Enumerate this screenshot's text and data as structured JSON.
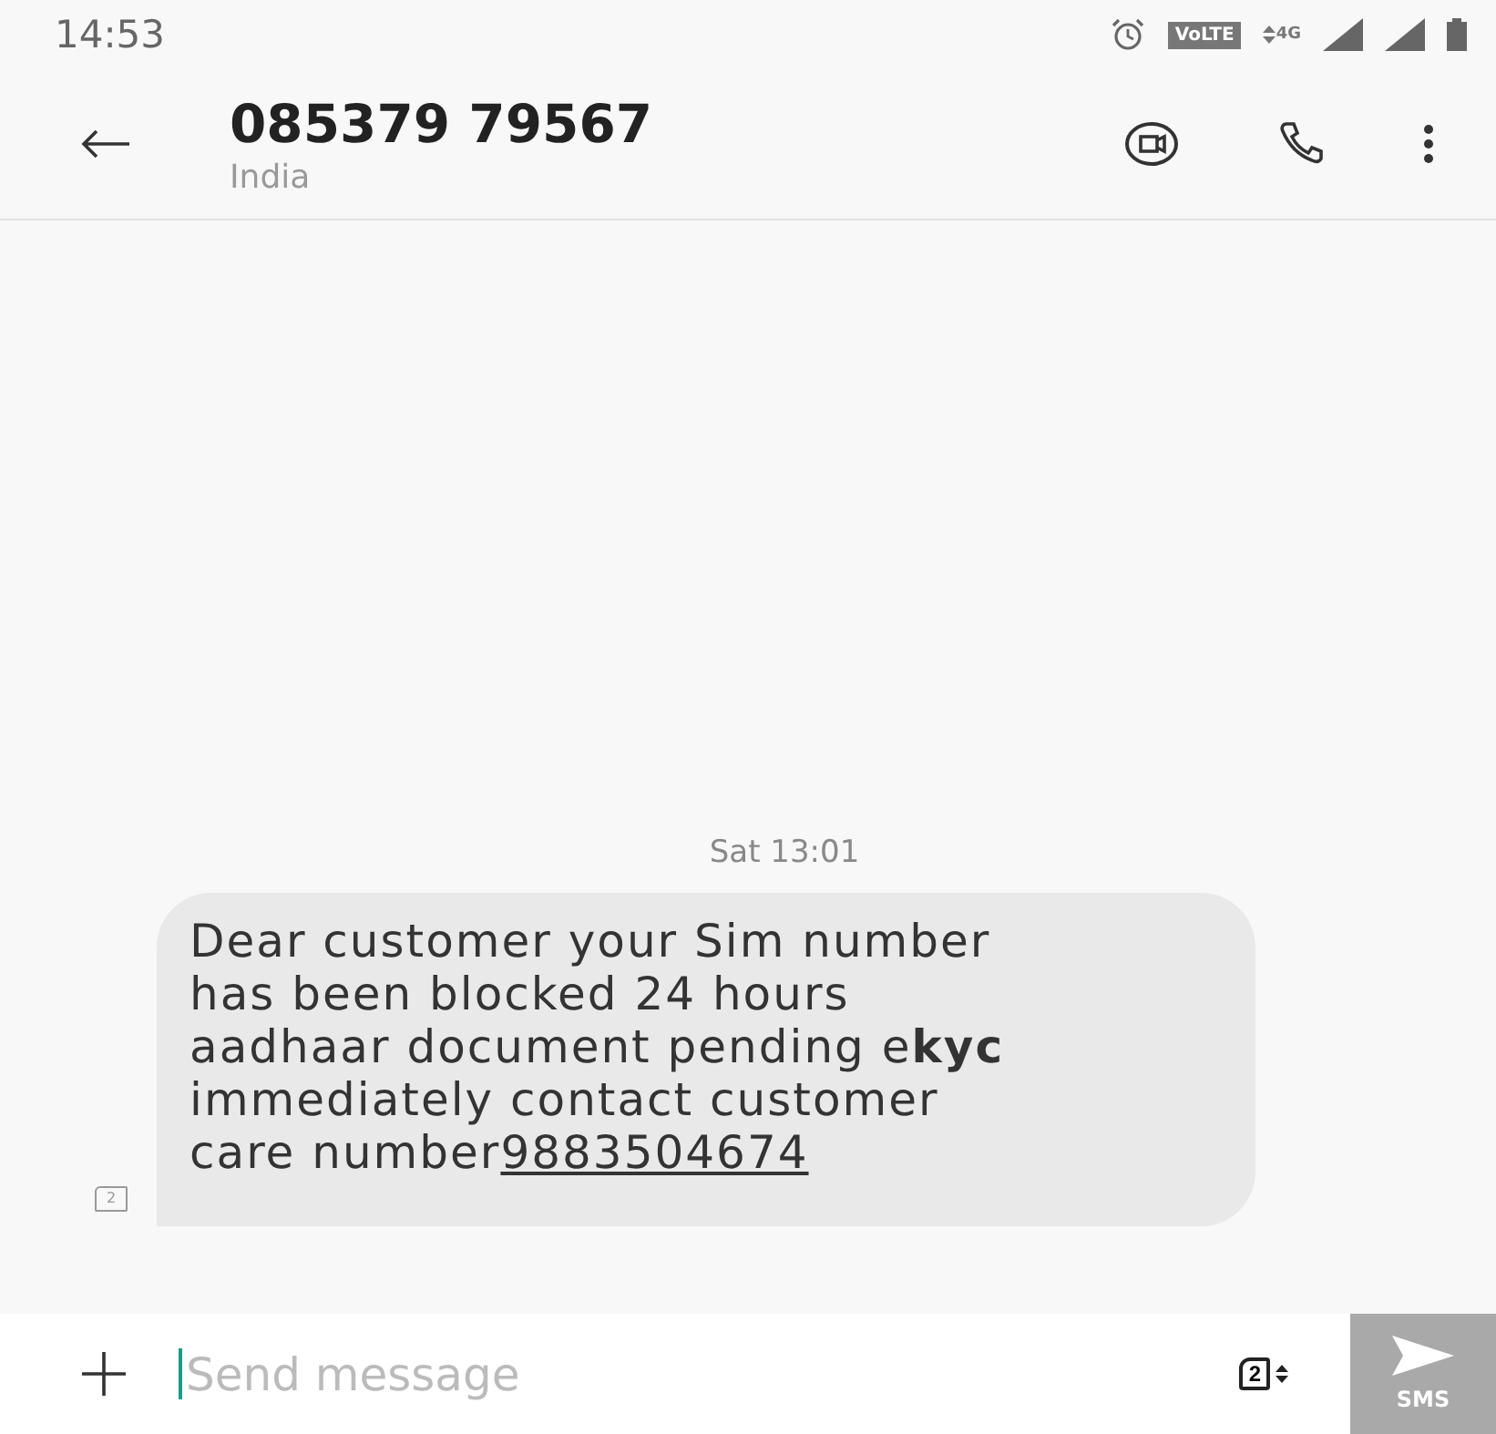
{
  "status_bar": {
    "time": "14:53",
    "volte": "VoLTE",
    "network": "4G"
  },
  "header": {
    "title": "085379 79567",
    "subtitle": "India"
  },
  "conversation": {
    "timestamp": "Sat 13:01",
    "sim_label": "2",
    "message": {
      "text": "Dear customer your Sim number has been blocked 24 hours aadhaar document pending e**kyc** immediately contact customer care number",
      "link": "9883504674"
    }
  },
  "composer": {
    "placeholder": "Send message",
    "sim": "2",
    "send_label": "SMS",
    "send_enabled": false
  }
}
